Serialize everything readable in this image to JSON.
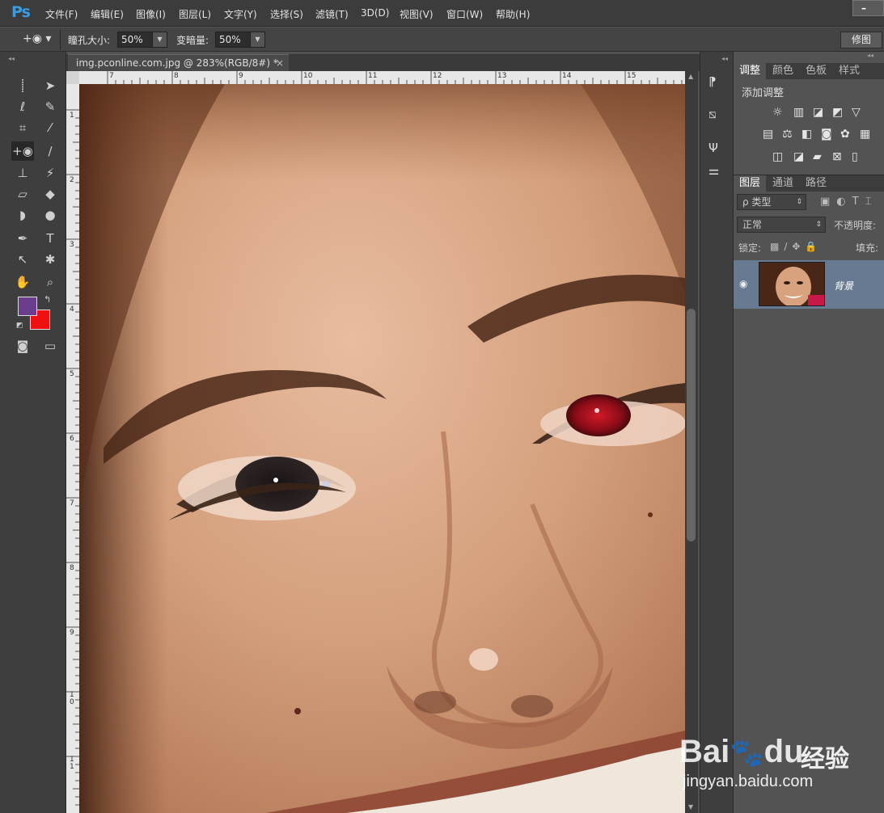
{
  "app": {
    "logo": "Ps"
  },
  "menu": [
    "文件(F)",
    "编辑(E)",
    "图像(I)",
    "图层(L)",
    "文字(Y)",
    "选择(S)",
    "滤镜(T)",
    "3D(D)",
    "视图(V)",
    "窗口(W)",
    "帮助(H)"
  ],
  "window_controls": {
    "minimize": "–"
  },
  "options": {
    "pupil_label": "瞳孔大小:",
    "pupil_value": "50%",
    "darken_label": "变暗量:",
    "darken_value": "50%",
    "repair_button": "修图"
  },
  "document": {
    "tab_title": "img.pconline.com.jpg @ 283%(RGB/8#) *",
    "close": "×"
  },
  "ruler": {
    "h_labels": [
      "7",
      "8",
      "9",
      "10",
      "11",
      "12",
      "13",
      "14",
      "15"
    ],
    "v_labels": [
      "1",
      "2",
      "3",
      "4",
      "5",
      "6",
      "7",
      "8",
      "9",
      "10",
      "11"
    ]
  },
  "colors": {
    "foreground": "#6a3d8d",
    "background": "#f01010",
    "accent": "#3b9be0"
  },
  "panels": {
    "adjust_tabs": [
      "调整",
      "颜色",
      "色板",
      "样式"
    ],
    "add_adjustment": "添加调整",
    "layers_tabs": [
      "图层",
      "通道",
      "路径"
    ],
    "filter_kind": "ρ 类型",
    "blend_mode": "正常",
    "opacity_label": "不透明度:",
    "lock_label": "锁定:",
    "fill_label": "填充:",
    "layer_name": "背景"
  },
  "icons": {
    "eye": "eye-icon",
    "red_eye_tool": "red-eye-tool-icon"
  },
  "watermark": {
    "brand": "Bai",
    "brand2": "du",
    "suffix": "经验",
    "url": "jingyan.baidu.com"
  }
}
